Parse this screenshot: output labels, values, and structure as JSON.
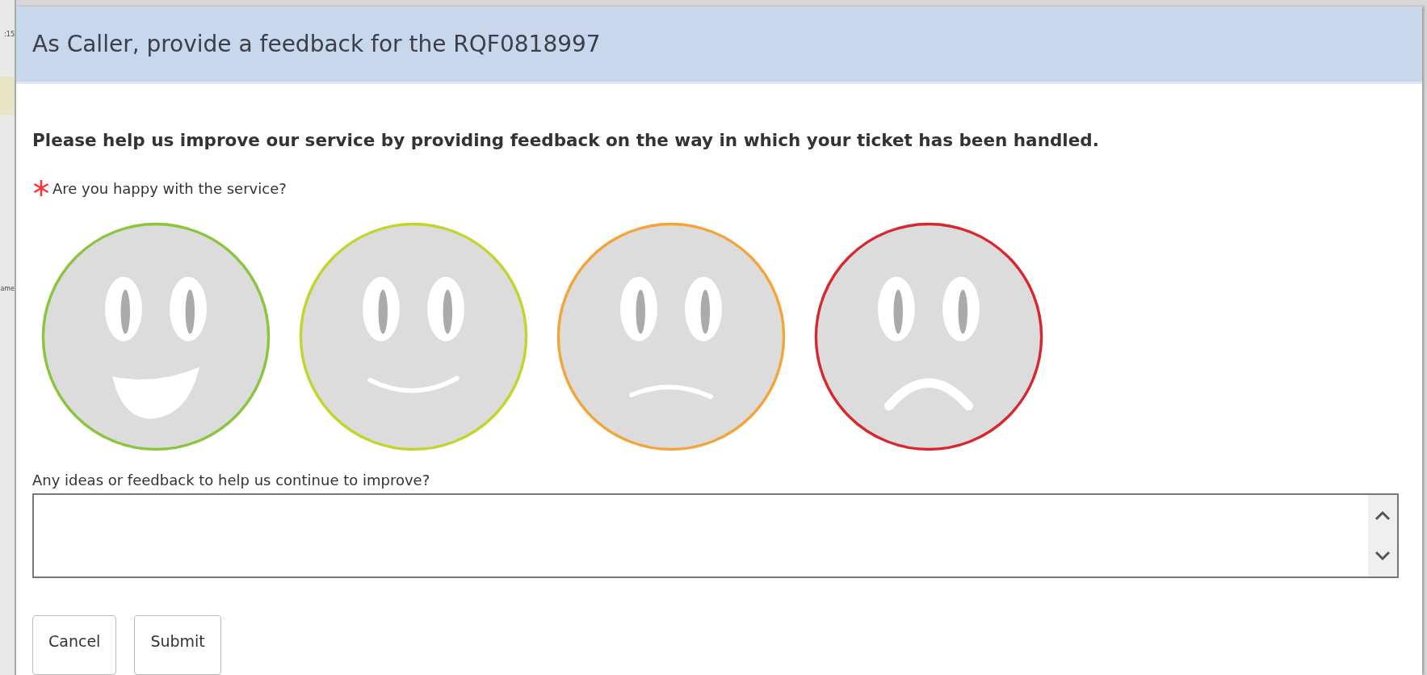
{
  "background_window": {
    "texts": [
      ":15",
      "ame"
    ]
  },
  "dialog": {
    "title": "As Caller, provide a feedback for the RQF0818997",
    "intro": "Please help us improve our service by providing feedback on the way in which your ticket has been handled.",
    "question": {
      "required": true,
      "label": "Are you happy with the service?"
    },
    "faces": [
      {
        "kind": "very-happy",
        "color": "#8cc43f"
      },
      {
        "kind": "happy",
        "color": "#c3d42c"
      },
      {
        "kind": "sad",
        "color": "#f2a53a"
      },
      {
        "kind": "very-sad",
        "color": "#d8282f"
      }
    ],
    "comment_label": "Any ideas or feedback to help us continue to improve?",
    "buttons": [
      "Cancel",
      "Submit"
    ]
  }
}
